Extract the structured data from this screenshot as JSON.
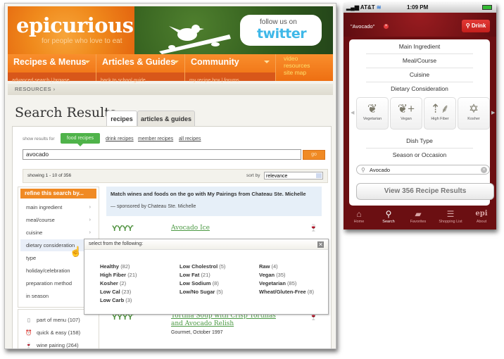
{
  "web": {
    "logo": "epicurious",
    "tagline": "for people who love to eat",
    "twitter": {
      "follow_label": "follow us on",
      "brand": "twitter"
    },
    "nav": [
      {
        "label": "Recipes & Menus",
        "sub": "advanced search | browse"
      },
      {
        "label": "Articles & Guides",
        "sub": "back to school guide"
      },
      {
        "label": "Community",
        "sub": "my recipe box | forums"
      }
    ],
    "nav_extra": [
      "video",
      "resources",
      "site map"
    ],
    "breadcrumb": "RESOURCES ›",
    "page_title": "Search Results",
    "tabs": [
      {
        "label": "recipes",
        "active": true
      },
      {
        "label": "articles & guides",
        "active": false
      }
    ],
    "show_results_for": "show results for",
    "filters": [
      {
        "label": "food recipes",
        "active": true
      },
      {
        "label": "drink recipes",
        "active": false
      },
      {
        "label": "member recipes",
        "active": false
      },
      {
        "label": "all recipes",
        "active": false
      }
    ],
    "search": {
      "value": "avocado",
      "go_label": "go"
    },
    "showing": "showing 1 - 10 of 356",
    "sort": {
      "label": "sort by",
      "value": "relevance"
    },
    "refine": {
      "heading": "refine this search by...",
      "items": [
        {
          "label": "main ingredient",
          "chevron": "›"
        },
        {
          "label": "meal/course",
          "chevron": "›"
        },
        {
          "label": "cuisine",
          "chevron": "›"
        },
        {
          "label": "dietary consideration",
          "chevron": ""
        },
        {
          "label": "type",
          "chevron": ""
        },
        {
          "label": "holiday/celebration",
          "chevron": ""
        },
        {
          "label": "preparation method",
          "chevron": ""
        },
        {
          "label": "in season",
          "chevron": ""
        }
      ]
    },
    "quick_filters": [
      {
        "icon": "menu-icon",
        "label": "part of menu (107)"
      },
      {
        "icon": "alarm-clock-icon",
        "label": "quick & easy (158)"
      },
      {
        "icon": "wine-glass-icon",
        "label": "wine pairing (264)"
      }
    ],
    "promo": {
      "title": "Match wines and foods on the go with My Pairings from Chateau Ste. Michelle",
      "sponsor": "— sponsored by Chateau Ste. Michelle"
    },
    "results": [
      {
        "title": "Avocado Ice",
        "forks": "ϒϒϒϒ",
        "source": ""
      },
      {
        "title": "Tortilla Soup with Crisp Tortillas and Avocado Relish",
        "forks": "ϒϒϒϒ",
        "source": "Gourmet, October 1997"
      }
    ],
    "popup": {
      "heading": "select from the following:",
      "close": "✕",
      "columns": [
        [
          {
            "name": "Healthy",
            "count": "(82)"
          },
          {
            "name": "High Fiber",
            "count": "(21)"
          },
          {
            "name": "Kosher",
            "count": "(2)"
          },
          {
            "name": "Low Cal",
            "count": "(23)"
          },
          {
            "name": "Low Carb",
            "count": "(3)"
          }
        ],
        [
          {
            "name": "Low Cholestrol",
            "count": "(5)"
          },
          {
            "name": "Low Fat",
            "count": "(21)"
          },
          {
            "name": "Low Sodium",
            "count": "(8)"
          },
          {
            "name": "Low/No Sugar",
            "count": "(5)"
          }
        ],
        [
          {
            "name": "Raw",
            "count": "(4)"
          },
          {
            "name": "Vegan",
            "count": "(35)"
          },
          {
            "name": "Vegetarian",
            "count": "(85)"
          },
          {
            "name": "Wheat/Gluten-Free",
            "count": "(8)"
          }
        ]
      ]
    }
  },
  "phone": {
    "status": {
      "carrier": "AT&T",
      "time": "1:09 PM"
    },
    "query": "\"Avocado\"",
    "drink_button": "Drink",
    "rows_top": [
      "Main Ingredient",
      "Meal/Course",
      "Cuisine",
      "Dietary Consideration"
    ],
    "dietary_tiles": [
      {
        "label": "Vegetarian",
        "glyph": "❦"
      },
      {
        "label": "Vegan",
        "glyph": "❦+"
      },
      {
        "label": "High Fiber",
        "glyph": "⇡⸙"
      },
      {
        "label": "Kosher",
        "glyph": "✡"
      }
    ],
    "rows_bottom": [
      "Dish Type",
      "Season or Occasion"
    ],
    "search_value": "Avocado",
    "view_button": "View 356 Recipe Results",
    "tabs": [
      {
        "label": "Home",
        "glyph": "⌂",
        "active": false
      },
      {
        "label": "Search",
        "glyph": "⚲",
        "active": true
      },
      {
        "label": "Favorites",
        "glyph": "▰",
        "active": false
      },
      {
        "label": "Shopping List",
        "glyph": "☰",
        "active": false
      },
      {
        "label": "About",
        "glyph": "epi",
        "active": false
      }
    ]
  }
}
